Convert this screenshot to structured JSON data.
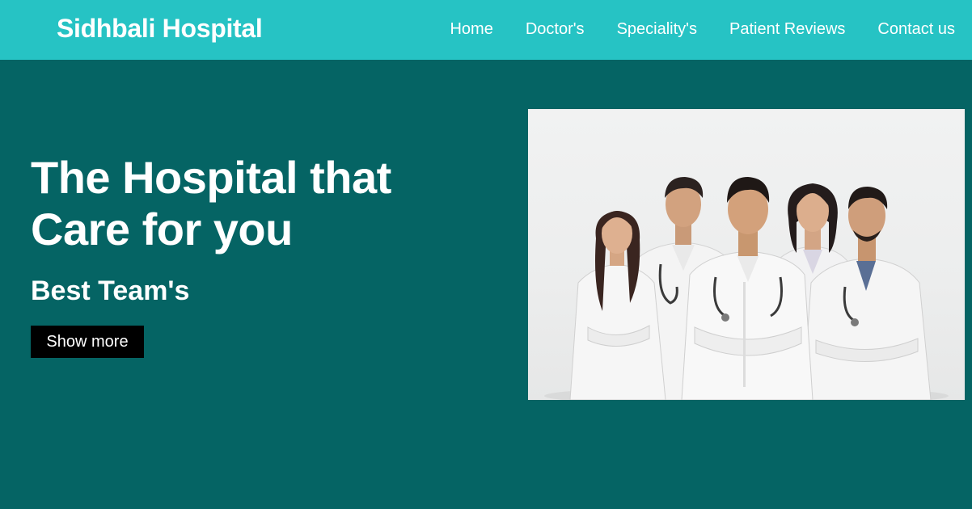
{
  "brand": {
    "name": "Sidhbali Hospital"
  },
  "nav": {
    "items": [
      {
        "label": "Home"
      },
      {
        "label": "Doctor's"
      },
      {
        "label": "Speciality's"
      },
      {
        "label": "Patient Reviews"
      },
      {
        "label": "Contact us"
      }
    ]
  },
  "hero": {
    "title": "The Hospital that Care for you",
    "subtitle": "Best Team's",
    "cta_label": "Show more",
    "image_alt": "Team of five doctors in white coats with stethoscopes"
  },
  "colors": {
    "navbar_bg": "#26c3c4",
    "page_bg": "#056464",
    "button_bg": "#000000",
    "text": "#ffffff"
  }
}
